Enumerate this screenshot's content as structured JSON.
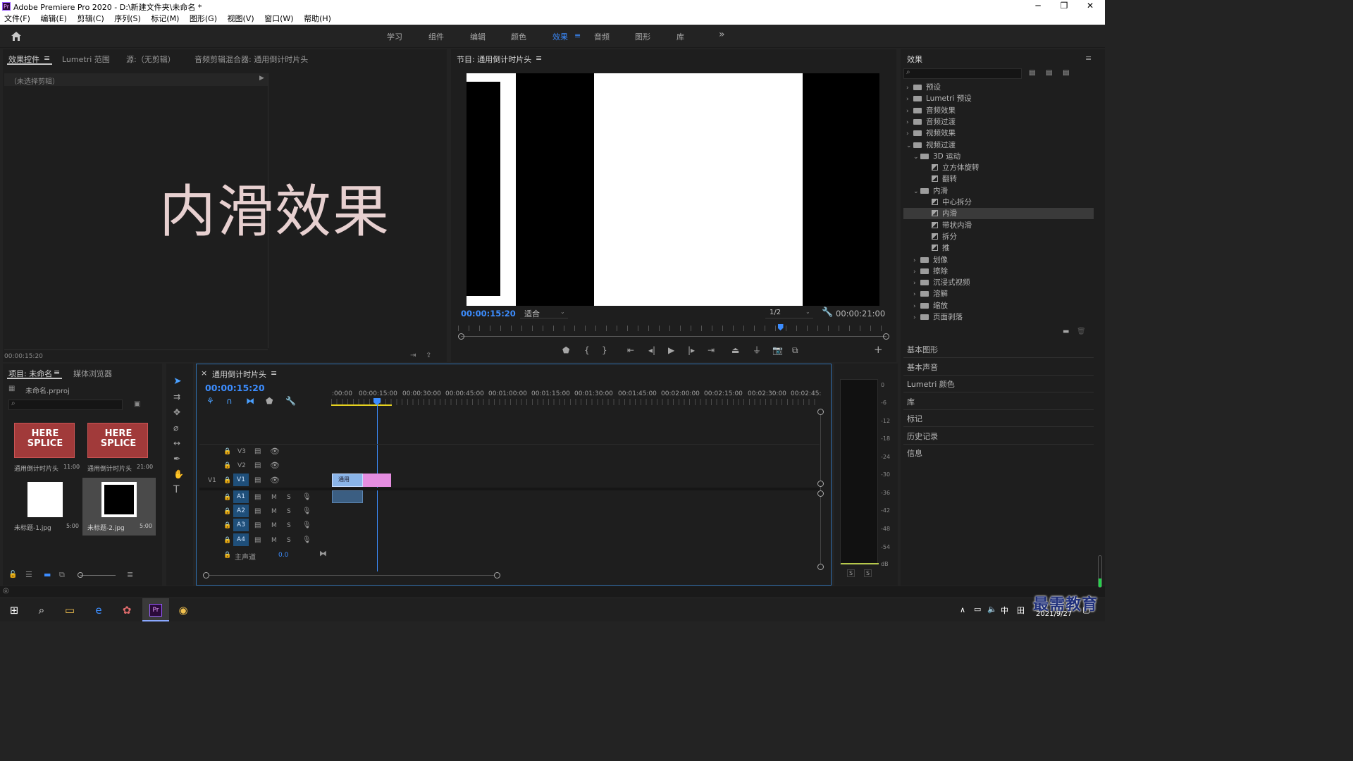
{
  "window": {
    "title": "Adobe Premiere Pro 2020 - D:\\新建文件夹\\未命名 *",
    "app_icon": "Pr"
  },
  "menu": [
    "文件(F)",
    "编辑(E)",
    "剪辑(C)",
    "序列(S)",
    "标记(M)",
    "图形(G)",
    "视图(V)",
    "窗口(W)",
    "帮助(H)"
  ],
  "workspaces": {
    "items": [
      "学习",
      "组件",
      "编辑",
      "颜色",
      "效果",
      "音频",
      "图形",
      "库"
    ],
    "active": "效果",
    "more": "»"
  },
  "source_panel": {
    "tabs": [
      "效果控件",
      "Lumetri 范围",
      "源:（无剪辑）",
      "音频剪辑混合器: 通用倒计时片头"
    ],
    "active_tab_menu": "≡",
    "no_clip": "（未选择剪辑）",
    "overlay_text": "内滑效果",
    "timecode": "00:00:15:20"
  },
  "program": {
    "title": "节目: 通用倒计时片头",
    "menu": "≡",
    "timecode": "00:00:15:20",
    "fit": "适合",
    "resolution": "1/2",
    "duration": "00:00:21:00",
    "playhead_fraction": 0.75
  },
  "effects_panel": {
    "title": "效果",
    "menu": "≡",
    "search_placeholder": "",
    "tree": [
      {
        "label": "预设",
        "type": "folder-special",
        "depth": 0,
        "state": "collapsed"
      },
      {
        "label": "Lumetri 预设",
        "type": "folder-special",
        "depth": 0,
        "state": "collapsed"
      },
      {
        "label": "音频效果",
        "type": "folder",
        "depth": 0,
        "state": "collapsed"
      },
      {
        "label": "音频过渡",
        "type": "folder",
        "depth": 0,
        "state": "collapsed"
      },
      {
        "label": "视频效果",
        "type": "folder",
        "depth": 0,
        "state": "collapsed"
      },
      {
        "label": "视频过渡",
        "type": "folder",
        "depth": 0,
        "state": "expanded"
      },
      {
        "label": "3D 运动",
        "type": "folder",
        "depth": 1,
        "state": "expanded"
      },
      {
        "label": "立方体旋转",
        "type": "effect",
        "depth": 2
      },
      {
        "label": "翻转",
        "type": "effect",
        "depth": 2
      },
      {
        "label": "内滑",
        "type": "folder",
        "depth": 1,
        "state": "expanded"
      },
      {
        "label": "中心拆分",
        "type": "effect",
        "depth": 2
      },
      {
        "label": "内滑",
        "type": "effect",
        "depth": 2,
        "selected": true
      },
      {
        "label": "带状内滑",
        "type": "effect",
        "depth": 2
      },
      {
        "label": "拆分",
        "type": "effect",
        "depth": 2
      },
      {
        "label": "推",
        "type": "effect",
        "depth": 2
      },
      {
        "label": "划像",
        "type": "folder",
        "depth": 1,
        "state": "collapsed"
      },
      {
        "label": "擦除",
        "type": "folder",
        "depth": 1,
        "state": "collapsed"
      },
      {
        "label": "沉浸式视频",
        "type": "folder",
        "depth": 1,
        "state": "collapsed"
      },
      {
        "label": "溶解",
        "type": "folder",
        "depth": 1,
        "state": "collapsed"
      },
      {
        "label": "缩放",
        "type": "folder",
        "depth": 1,
        "state": "collapsed"
      },
      {
        "label": "页面剥落",
        "type": "folder",
        "depth": 1,
        "state": "collapsed"
      }
    ]
  },
  "side_panels": [
    "基本图形",
    "基本声音",
    "Lumetri 颜色",
    "库",
    "标记",
    "历史记录",
    "信息"
  ],
  "project_panel": {
    "tabs": [
      "项目: 未命名",
      "媒体浏览器"
    ],
    "menu": "≡",
    "project_file": "未命名.prproj",
    "items": [
      {
        "name": "通用倒计时片头",
        "duration": "11:00",
        "thumb": "countdown"
      },
      {
        "name": "通用倒计时片头",
        "duration": "21:00",
        "thumb": "countdown"
      },
      {
        "name": "未标题-1.jpg",
        "duration": "5:00",
        "thumb": "white"
      },
      {
        "name": "未标题-2.jpg",
        "duration": "5:00",
        "thumb": "black",
        "selected": true
      }
    ],
    "thumb_text": "HERE SPLICE"
  },
  "timeline": {
    "tab_title": "通用倒计时片头",
    "close": "×",
    "menu": "≡",
    "timecode": "00:00:15:20",
    "ruler": [
      ":00:00",
      "00:00:15:00",
      "00:00:30:00",
      "00:00:45:00",
      "00:01:00:00",
      "00:01:15:00",
      "00:01:30:00",
      "00:01:45:00",
      "00:02:00:00",
      "00:02:15:00",
      "00:02:30:00",
      "00:02:45:"
    ],
    "video_tracks": [
      "V3",
      "V2",
      "V1"
    ],
    "audio_tracks": [
      "A1",
      "A2",
      "A3",
      "A4"
    ],
    "source_patch_v": "V1",
    "mute": "M",
    "solo": "S",
    "master_label": "主声道",
    "master_value": "0.0",
    "clip_label": "通用"
  },
  "audio_meter": {
    "scale": [
      "0",
      "-6",
      "-12",
      "-18",
      "-24",
      "-30",
      "-36",
      "-42",
      "-48",
      "-54",
      "dB"
    ],
    "solo_buttons": [
      "S",
      "S"
    ]
  },
  "taskbar": {
    "time": "",
    "date": "2021/9/27",
    "ime": "中",
    "watermark": "最需教育"
  }
}
